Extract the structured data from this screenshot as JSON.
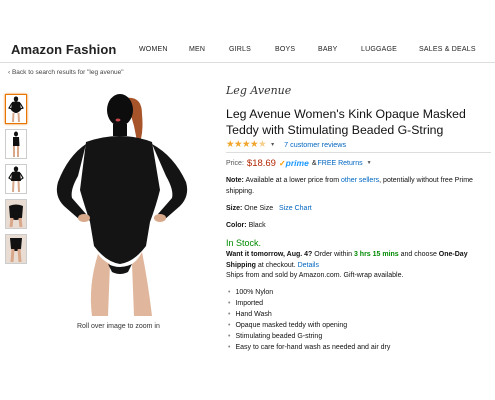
{
  "header": {
    "brand": "Amazon Fashion",
    "nav": [
      "WOMEN",
      "MEN",
      "GIRLS",
      "BOYS",
      "BABY",
      "LUGGAGE",
      "SALES & DEALS"
    ]
  },
  "breadcrumb": {
    "back_link": "‹ Back to search results for \"leg avenue\""
  },
  "gallery": {
    "thumbnail_count": 5,
    "selected_index": 0,
    "zoom_hint": "Roll over image to zoom in"
  },
  "product": {
    "brand_logo": "Leg Avenue",
    "title": "Leg Avenue Women's Kink Opaque Masked Teddy with Stimulating Beaded G-String",
    "rating_stars": 3.5,
    "reviews_text": "7 customer reviews",
    "price_label": "Price:",
    "price": "$18.69",
    "prime_label": "prime",
    "free_returns_prefix": "& ",
    "free_returns": "FREE Returns",
    "note_label": "Note:",
    "note_text_1": " Available at a lower price from ",
    "note_link": "other sellers",
    "note_text_2": ", potentially without free Prime shipping.",
    "size_label": "Size:",
    "size_value": "One Size",
    "size_chart": "Size Chart",
    "color_label": "Color:",
    "color_value": "Black",
    "stock": "In Stock.",
    "delivery_1": "Want it tomorrow, Aug. 4?",
    "delivery_2": " Order within ",
    "delivery_time": "3 hrs 15 mins",
    "delivery_3": " and choose ",
    "delivery_4": "One-Day Shipping",
    "delivery_5": " at checkout. ",
    "delivery_details": "Details",
    "ships_from": "Ships from and sold by Amazon.com. Gift-wrap available.",
    "bullets": [
      "100% Nylon",
      "Imported",
      "Hand Wash",
      "Opaque masked teddy with opening",
      "Stimulating beaded G-string",
      "Easy to care for-hand wash as needed and air dry"
    ]
  },
  "colors": {
    "link": "#0066c0",
    "price": "#b12704",
    "in_stock": "#008a00",
    "star": "#f0a52b",
    "prime": "#1a98ff",
    "thumb_selected": "#e77600"
  }
}
